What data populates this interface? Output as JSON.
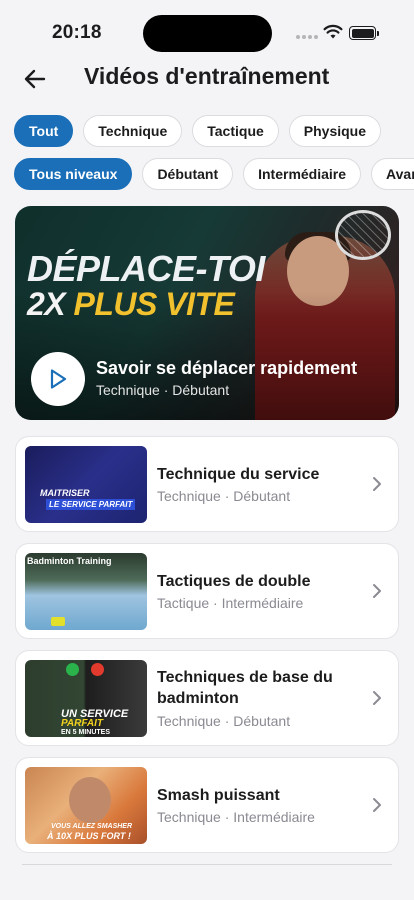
{
  "status": {
    "time": "20:18"
  },
  "header": {
    "title": "Vidéos d'entraînement"
  },
  "categories": [
    {
      "label": "Tout",
      "active": true
    },
    {
      "label": "Technique",
      "active": false
    },
    {
      "label": "Tactique",
      "active": false
    },
    {
      "label": "Physique",
      "active": false
    }
  ],
  "levels": [
    {
      "label": "Tous niveaux",
      "active": true
    },
    {
      "label": "Débutant",
      "active": false
    },
    {
      "label": "Intermédiaire",
      "active": false
    },
    {
      "label": "Avancé",
      "active": false
    }
  ],
  "featured": {
    "thumb_line1": "DÉPLACE-TOI",
    "thumb_line2_a": "2X ",
    "thumb_line2_b": "PLUS VITE",
    "title": "Savoir se déplacer rapidement",
    "subtitle": "Technique · Débutant"
  },
  "videos": [
    {
      "title": "Technique du service",
      "subtitle": "Technique · Débutant",
      "thumb_text1": "MAITRISER",
      "thumb_text2": "LE SERVICE PARFAIT"
    },
    {
      "title": "Tactiques de double",
      "subtitle": "Tactique · Intermédiaire",
      "thumb_text1": "Badminton Training"
    },
    {
      "title": "Techniques de base du badminton",
      "subtitle": "Technique · Débutant",
      "thumb_text1": "UN SERVICE",
      "thumb_text2": "PARFAIT",
      "thumb_text3": "EN 5 MINUTES"
    },
    {
      "title": "Smash puissant",
      "subtitle": "Technique · Intermédiaire",
      "thumb_text1": "VOUS ALLEZ SMASHER",
      "thumb_text2": "À 10X PLUS FORT !"
    }
  ],
  "colors": {
    "accent": "#1a6fb8",
    "background": "#f4f4f6",
    "highlight": "#f2c12e"
  }
}
